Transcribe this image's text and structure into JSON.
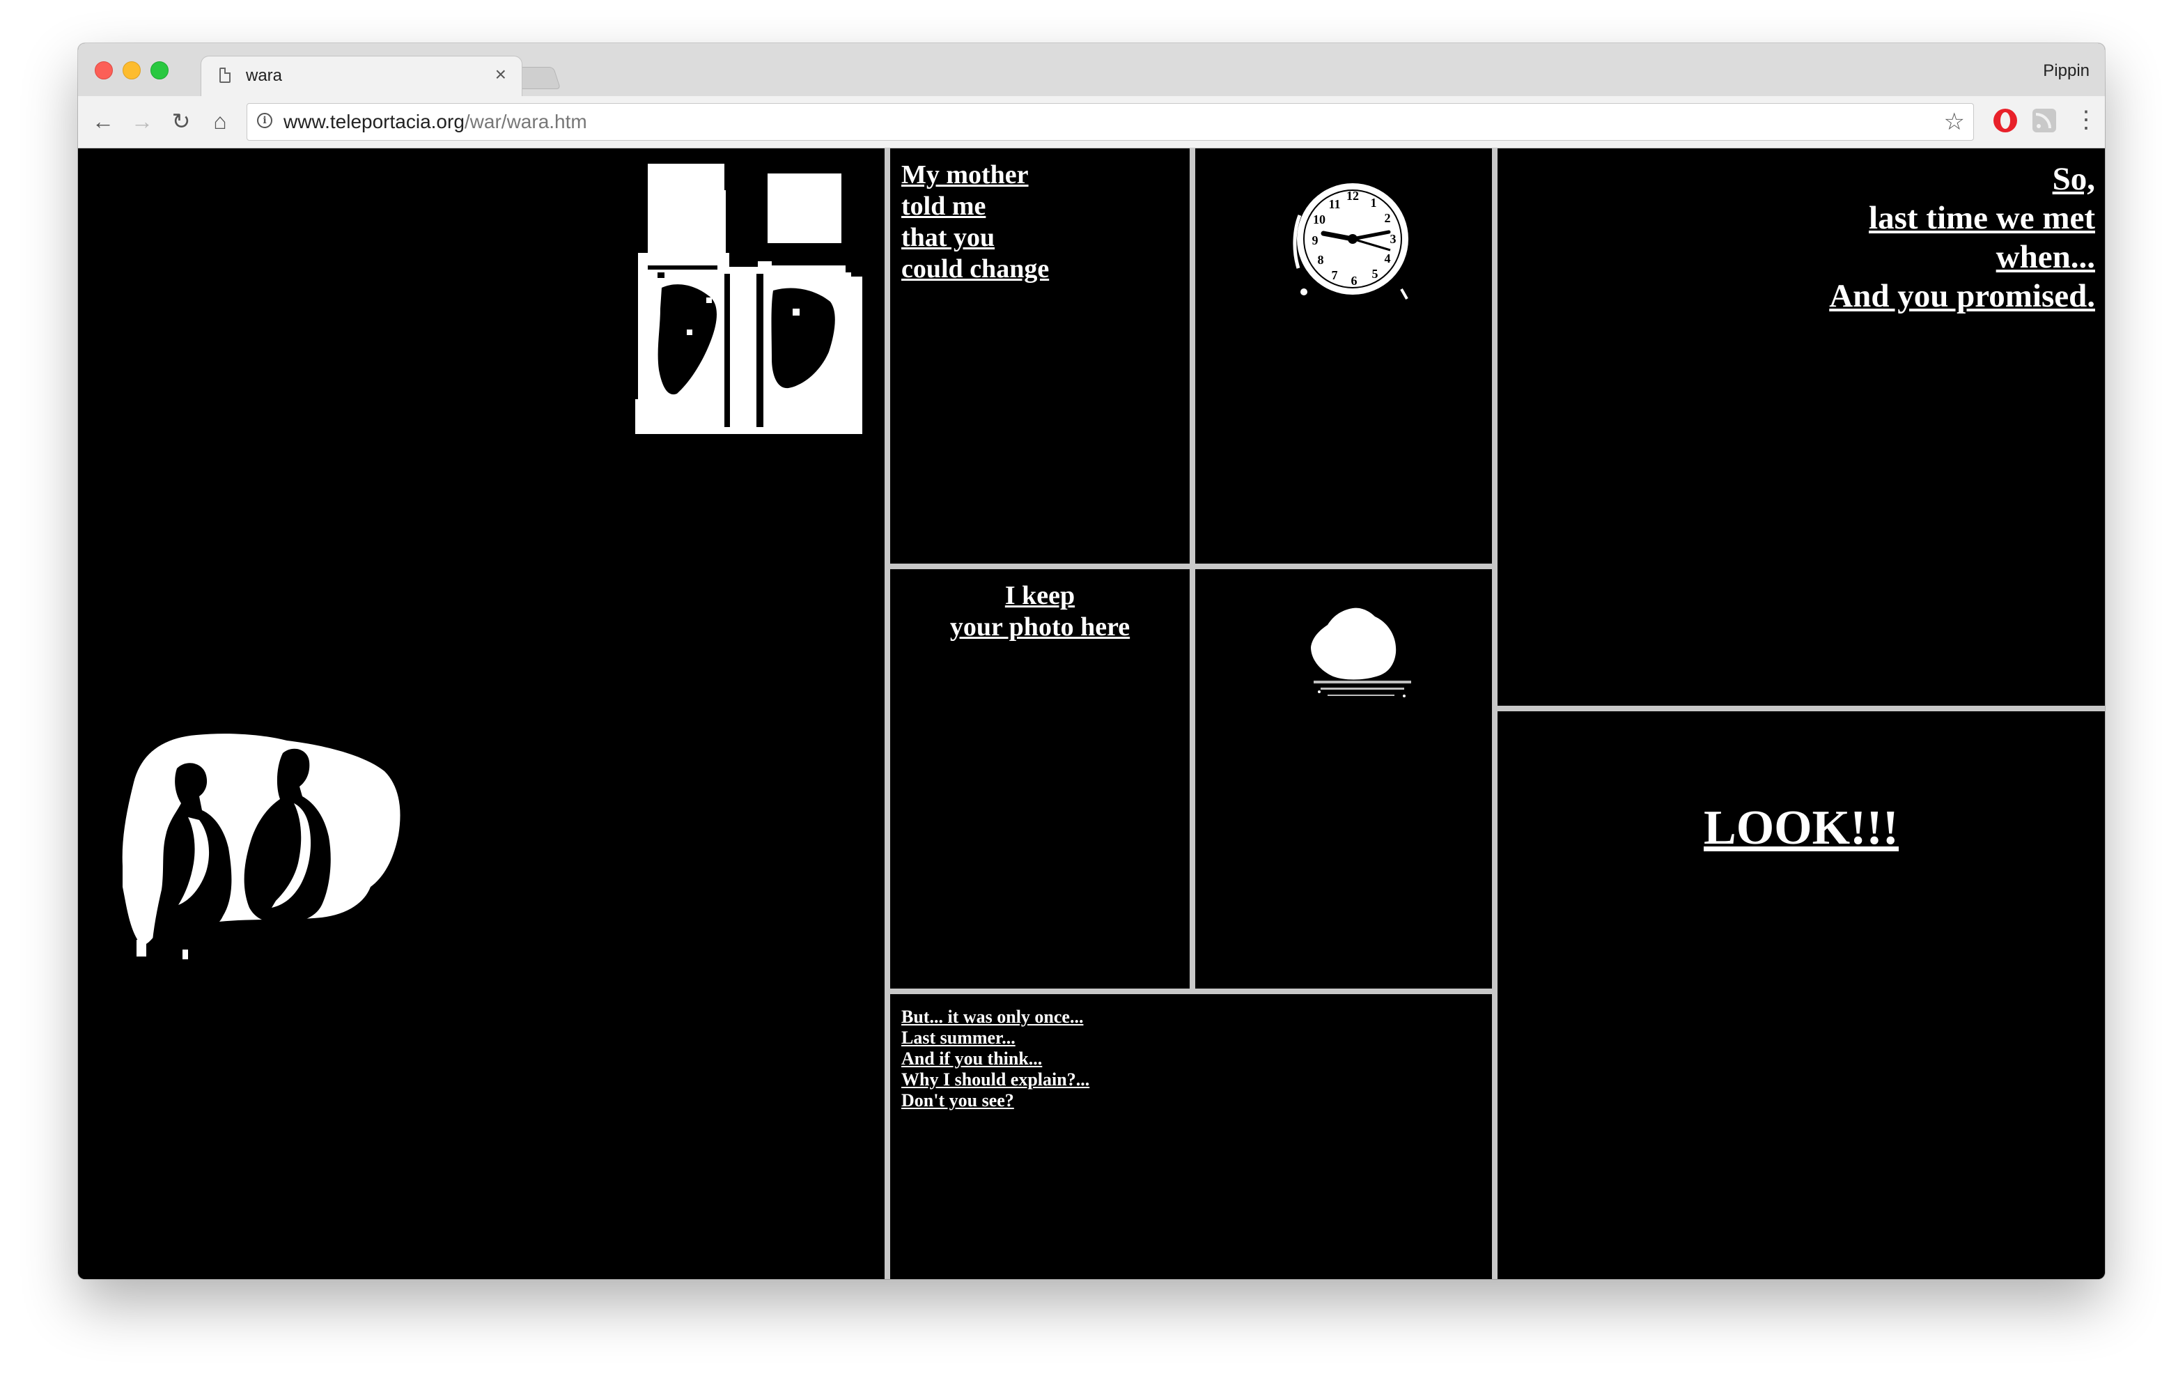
{
  "browser": {
    "tab_title": "wara",
    "tab_close": "×",
    "profile_name": "Pippin",
    "url_host": "www.teleportacia.org",
    "url_path": "/war/wara.htm",
    "info_glyph": "i",
    "star_glyph": "☆",
    "menu_glyph": "⋮",
    "nav": {
      "back": "←",
      "forward": "→",
      "reload": "↻",
      "home": "⌂"
    }
  },
  "frames": {
    "mother": {
      "lines": [
        "My mother ",
        "told me",
        "that you",
        "could change"
      ]
    },
    "keep": {
      "lines": [
        "I keep ",
        "your photo here"
      ]
    },
    "so": {
      "lines": [
        "So,",
        "last time we met ",
        "when...",
        "And you promised."
      ]
    },
    "look": {
      "text": "LOOK!!!"
    },
    "once": {
      "lines": [
        "But... it was only once...",
        "Last summer...",
        "And if you think...",
        "Why I should explain?... ",
        "Don't you see?"
      ]
    }
  },
  "images": {
    "window_photo": "window-image",
    "couple_photo": "couple-on-sofa-image",
    "clock_photo": "alarm-clock-image",
    "lamp_photo": "glowing-lamp-image"
  },
  "colors": {
    "page_background": "#000000",
    "frame_border": "#c8c8c8",
    "text": "#ffffff"
  }
}
